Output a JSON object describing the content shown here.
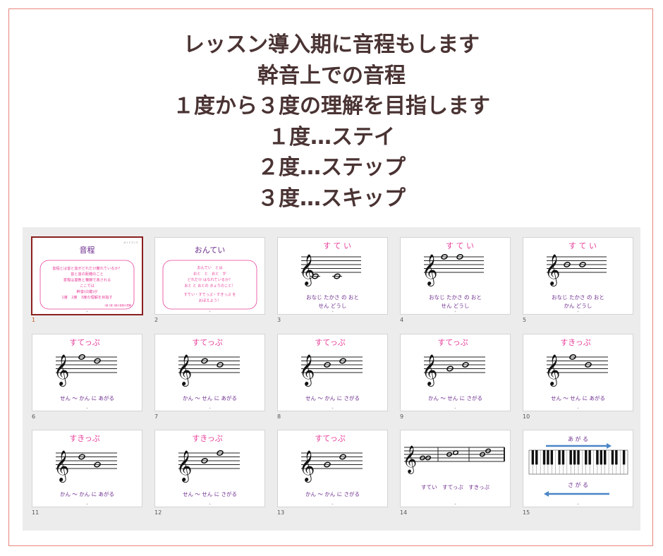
{
  "headline": [
    "レッスン導入期に音程もします",
    "幹音上での音程",
    "１度から３度の理解を目指します",
    "１度…ステイ",
    "２度…ステップ",
    "３度…スキップ"
  ],
  "colors": {
    "frame": "#e8857d",
    "title": "#4a3333",
    "pink": "#e8409a",
    "purple": "#6b2a8c",
    "selection": "#8a1f1f"
  },
  "slides": [
    {
      "num": "1",
      "kind": "text",
      "title": "音程",
      "corner": "ガイドブック",
      "lines": [
        "音程とは音と音がどれだけ離れているか？",
        "音と音の距離のこと",
        "音程は度数と種類で表される",
        "ここでは",
        "幹音(白鍵)が",
        "1度　2度　3度の理解を目指す"
      ],
      "footnote": "1度 2度 3度の音程の理解"
    },
    {
      "num": "2",
      "kind": "text",
      "title": "おんてい",
      "lines": [
        "おんてい　とは",
        "おと　と　おと　が",
        "どれだけ はなれているか？",
        "おと と おとの きょりのこと！",
        "すてい・すてっぷ・すきっぷ を",
        "おぼえよう！"
      ]
    },
    {
      "num": "3",
      "kind": "staff",
      "title": "す て い",
      "caption": [
        "おなじ たかさ の おと",
        "せん どうし"
      ]
    },
    {
      "num": "4",
      "kind": "staff",
      "title": "す て い",
      "caption": [
        "おなじ たかさ の おと",
        "せん どうし"
      ]
    },
    {
      "num": "5",
      "kind": "staff",
      "title": "す て い",
      "caption": [
        "おなじ たかさ の おと",
        "かん どうし"
      ]
    },
    {
      "num": "6",
      "kind": "staff",
      "title": "すてっぷ",
      "caption": [
        "せん ～ かん に あがる"
      ]
    },
    {
      "num": "7",
      "kind": "staff",
      "title": "すてっぷ",
      "caption": [
        "かん ～ せん に あがる"
      ]
    },
    {
      "num": "8",
      "kind": "staff",
      "title": "すてっぷ",
      "caption": [
        "せん ～ かん に さがる"
      ]
    },
    {
      "num": "9",
      "kind": "staff",
      "title": "すてっぷ",
      "caption": [
        "かん ～ せん に さがる"
      ]
    },
    {
      "num": "10",
      "kind": "staff",
      "title": "すきっぷ",
      "caption": [
        "せん ～ せん に あがる"
      ]
    },
    {
      "num": "11",
      "kind": "staff",
      "title": "すきっぷ",
      "caption": [
        "かん ～ かん に あがる"
      ]
    },
    {
      "num": "12",
      "kind": "staff",
      "title": "すきっぷ",
      "caption": [
        "せん ～ せん に さがる"
      ]
    },
    {
      "num": "13",
      "kind": "staff",
      "title": "すてっぷ",
      "caption": [
        "かん ～ かん に さがる"
      ]
    },
    {
      "num": "14",
      "kind": "summary",
      "caption": [
        "すてい　すてっぷ　すきっぷ"
      ]
    },
    {
      "num": "15",
      "kind": "keyboard",
      "up": "あ が る",
      "down": "さ が る"
    }
  ]
}
